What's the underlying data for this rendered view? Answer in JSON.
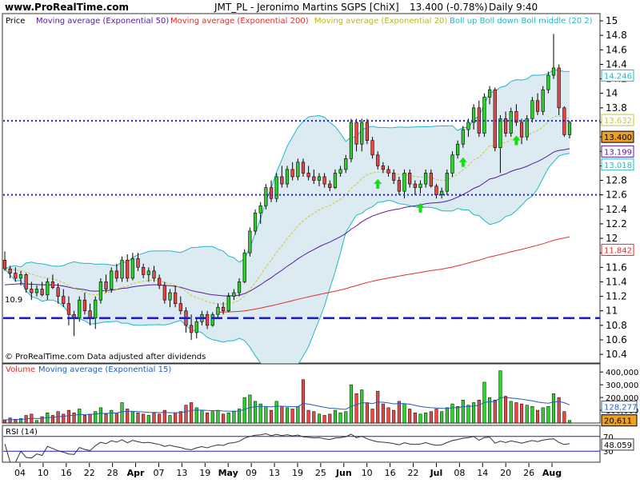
{
  "header": {
    "site": "www.ProRealTime.com",
    "title": "JMT_PL - Jeronimo Martins SGPS  [ChiX]",
    "price": "13.400 (-0.78%)",
    "period": "Daily  9:40"
  },
  "price_panel": {
    "label": "Price",
    "legend": [
      {
        "text": "Moving average (Exponential 50)",
        "color": "#5a189a"
      },
      {
        "text": "Moving average (Exponential 200)",
        "color": "#e0302a"
      },
      {
        "text": "Moving average (Exponential 20)",
        "color": "#c8c832"
      },
      {
        "text": "Boll up Boll down Boll middle (20 2)",
        "color": "#20b8c8"
      }
    ],
    "footer": "© ProRealTime.com  Data adjusted after dividends",
    "level_label": "10.9",
    "y_ticks": [
      "15",
      "14.8",
      "14.6",
      "14.4",
      "14.2",
      "14",
      "13.8",
      "13.6",
      "13.4",
      "13.2",
      "13",
      "12.8",
      "12.6",
      "12.4",
      "12.2",
      "12",
      "11.8",
      "11.6",
      "11.4",
      "11.2",
      "11",
      "10.8",
      "10.6",
      "10.4"
    ],
    "value_boxes": [
      {
        "text": "14.246",
        "value": 14.246,
        "color": "#20b8c8"
      },
      {
        "text": "13.632",
        "value": 13.632,
        "color": "#c8c832"
      },
      {
        "text": "13.400",
        "value": 13.4,
        "color": "#000000",
        "bg": "#f0a020"
      },
      {
        "text": "13.199",
        "value": 13.199,
        "color": "#5a189a"
      },
      {
        "text": "13.018",
        "value": 13.018,
        "color": "#20b8c8"
      },
      {
        "text": "11.842",
        "value": 11.842,
        "color": "#e0302a"
      }
    ]
  },
  "volume_panel": {
    "label": "Volume",
    "ma_label": "Moving average (Exponential 15)",
    "y_ticks": [
      "400,000",
      "300,000",
      "200,000",
      "100,000"
    ],
    "value_boxes": [
      {
        "text": "128,277",
        "value": 128277,
        "color": "#1f5fbf"
      },
      {
        "text": "20,611",
        "value": 20611,
        "color": "#000000",
        "bg": "#f0a020"
      }
    ]
  },
  "rsi_panel": {
    "label": "RSI (14)",
    "y_ticks": [
      "70",
      "30"
    ],
    "value_box": {
      "text": "48.059",
      "value": 48.059
    }
  },
  "x_axis": {
    "labels": [
      {
        "text": "04",
        "bold": false
      },
      {
        "text": "10",
        "bold": false
      },
      {
        "text": "16",
        "bold": false
      },
      {
        "text": "22",
        "bold": false
      },
      {
        "text": "28",
        "bold": false
      },
      {
        "text": "Apr",
        "bold": true
      },
      {
        "text": "07",
        "bold": false
      },
      {
        "text": "13",
        "bold": false
      },
      {
        "text": "19",
        "bold": false
      },
      {
        "text": "May",
        "bold": true
      },
      {
        "text": "09",
        "bold": false
      },
      {
        "text": "13",
        "bold": false
      },
      {
        "text": "19",
        "bold": false
      },
      {
        "text": "25",
        "bold": false
      },
      {
        "text": "Jun",
        "bold": true
      },
      {
        "text": "10",
        "bold": false
      },
      {
        "text": "16",
        "bold": false
      },
      {
        "text": "22",
        "bold": false
      },
      {
        "text": "Jul",
        "bold": true
      },
      {
        "text": "08",
        "bold": false
      },
      {
        "text": "14",
        "bold": false
      },
      {
        "text": "20",
        "bold": false
      },
      {
        "text": "26",
        "bold": false
      },
      {
        "text": "Aug",
        "bold": true
      }
    ]
  },
  "chart_data": {
    "type": "candlestick",
    "instrument": "JMT_PL - Jeronimo Martins SGPS [ChiX]",
    "ylim": [
      10.28,
      15.1
    ],
    "reference_lines": [
      13.62,
      12.6,
      10.9
    ],
    "arrows_at_candle": [
      70,
      78,
      86,
      96
    ],
    "candles": [
      {
        "o": 11.7,
        "h": 11.82,
        "l": 11.55,
        "c": 11.58,
        "v": 25000
      },
      {
        "o": 11.58,
        "h": 11.62,
        "l": 11.45,
        "c": 11.52,
        "v": 40000
      },
      {
        "o": 11.52,
        "h": 11.6,
        "l": 11.4,
        "c": 11.45,
        "v": 30000
      },
      {
        "o": 11.45,
        "h": 11.55,
        "l": 11.35,
        "c": 11.5,
        "v": 35000
      },
      {
        "o": 11.5,
        "h": 11.52,
        "l": 11.25,
        "c": 11.3,
        "v": 60000
      },
      {
        "o": 11.3,
        "h": 11.4,
        "l": 11.15,
        "c": 11.25,
        "v": 70000
      },
      {
        "o": 11.25,
        "h": 11.35,
        "l": 11.2,
        "c": 11.3,
        "v": 20000
      },
      {
        "o": 11.3,
        "h": 11.4,
        "l": 11.2,
        "c": 11.22,
        "v": 50000
      },
      {
        "o": 11.22,
        "h": 11.45,
        "l": 11.15,
        "c": 11.4,
        "v": 80000
      },
      {
        "o": 11.4,
        "h": 11.5,
        "l": 11.3,
        "c": 11.32,
        "v": 60000
      },
      {
        "o": 11.32,
        "h": 11.38,
        "l": 11.1,
        "c": 11.2,
        "v": 90000
      },
      {
        "o": 11.2,
        "h": 11.3,
        "l": 11.05,
        "c": 11.1,
        "v": 70000
      },
      {
        "o": 11.1,
        "h": 11.2,
        "l": 10.8,
        "c": 10.95,
        "v": 100000
      },
      {
        "o": 10.95,
        "h": 11.0,
        "l": 10.65,
        "c": 10.9,
        "v": 80000
      },
      {
        "o": 10.9,
        "h": 11.2,
        "l": 10.85,
        "c": 11.15,
        "v": 110000
      },
      {
        "o": 11.15,
        "h": 11.25,
        "l": 10.95,
        "c": 11.0,
        "v": 60000
      },
      {
        "o": 11.0,
        "h": 11.1,
        "l": 10.8,
        "c": 10.9,
        "v": 70000
      },
      {
        "o": 10.9,
        "h": 11.2,
        "l": 10.75,
        "c": 11.15,
        "v": 90000
      },
      {
        "o": 11.15,
        "h": 11.45,
        "l": 11.1,
        "c": 11.4,
        "v": 120000
      },
      {
        "o": 11.4,
        "h": 11.5,
        "l": 11.25,
        "c": 11.3,
        "v": 70000
      },
      {
        "o": 11.3,
        "h": 11.6,
        "l": 11.25,
        "c": 11.55,
        "v": 100000
      },
      {
        "o": 11.55,
        "h": 11.65,
        "l": 11.4,
        "c": 11.45,
        "v": 80000
      },
      {
        "o": 11.45,
        "h": 11.75,
        "l": 11.4,
        "c": 11.7,
        "v": 160000
      },
      {
        "o": 11.7,
        "h": 11.78,
        "l": 11.4,
        "c": 11.45,
        "v": 110000
      },
      {
        "o": 11.45,
        "h": 11.8,
        "l": 11.42,
        "c": 11.72,
        "v": 90000
      },
      {
        "o": 11.72,
        "h": 11.8,
        "l": 11.55,
        "c": 11.6,
        "v": 80000
      },
      {
        "o": 11.6,
        "h": 11.65,
        "l": 11.45,
        "c": 11.5,
        "v": 70000
      },
      {
        "o": 11.5,
        "h": 11.6,
        "l": 11.4,
        "c": 11.55,
        "v": 60000
      },
      {
        "o": 11.55,
        "h": 11.62,
        "l": 11.4,
        "c": 11.45,
        "v": 80000
      },
      {
        "o": 11.45,
        "h": 11.5,
        "l": 11.3,
        "c": 11.35,
        "v": 70000
      },
      {
        "o": 11.35,
        "h": 11.4,
        "l": 11.1,
        "c": 11.15,
        "v": 100000
      },
      {
        "o": 11.15,
        "h": 11.3,
        "l": 11.05,
        "c": 11.25,
        "v": 60000
      },
      {
        "o": 11.25,
        "h": 11.35,
        "l": 11.05,
        "c": 11.1,
        "v": 80000
      },
      {
        "o": 11.1,
        "h": 11.2,
        "l": 10.95,
        "c": 11.0,
        "v": 90000
      },
      {
        "o": 11.0,
        "h": 11.05,
        "l": 10.7,
        "c": 10.8,
        "v": 140000
      },
      {
        "o": 10.8,
        "h": 10.95,
        "l": 10.6,
        "c": 10.7,
        "v": 160000
      },
      {
        "o": 10.7,
        "h": 10.9,
        "l": 10.62,
        "c": 10.85,
        "v": 120000
      },
      {
        "o": 10.85,
        "h": 11.0,
        "l": 10.8,
        "c": 10.95,
        "v": 100000
      },
      {
        "o": 10.95,
        "h": 11.0,
        "l": 10.75,
        "c": 10.8,
        "v": 80000
      },
      {
        "o": 10.8,
        "h": 10.98,
        "l": 10.78,
        "c": 10.95,
        "v": 90000
      },
      {
        "o": 10.95,
        "h": 11.1,
        "l": 10.9,
        "c": 11.05,
        "v": 100000
      },
      {
        "o": 11.05,
        "h": 11.12,
        "l": 10.95,
        "c": 11.0,
        "v": 70000
      },
      {
        "o": 11.0,
        "h": 11.25,
        "l": 10.98,
        "c": 11.2,
        "v": 80000
      },
      {
        "o": 11.2,
        "h": 11.3,
        "l": 11.15,
        "c": 11.25,
        "v": 90000
      },
      {
        "o": 11.25,
        "h": 11.45,
        "l": 11.2,
        "c": 11.4,
        "v": 110000
      },
      {
        "o": 11.4,
        "h": 11.85,
        "l": 11.38,
        "c": 11.8,
        "v": 200000
      },
      {
        "o": 11.8,
        "h": 12.15,
        "l": 11.75,
        "c": 12.1,
        "v": 220000
      },
      {
        "o": 12.1,
        "h": 12.4,
        "l": 12.05,
        "c": 12.35,
        "v": 170000
      },
      {
        "o": 12.35,
        "h": 12.5,
        "l": 12.2,
        "c": 12.45,
        "v": 150000
      },
      {
        "o": 12.45,
        "h": 12.75,
        "l": 12.4,
        "c": 12.7,
        "v": 130000
      },
      {
        "o": 12.7,
        "h": 12.8,
        "l": 12.5,
        "c": 12.55,
        "v": 100000
      },
      {
        "o": 12.55,
        "h": 12.9,
        "l": 12.5,
        "c": 12.85,
        "v": 170000
      },
      {
        "o": 12.85,
        "h": 13.0,
        "l": 12.7,
        "c": 12.75,
        "v": 130000
      },
      {
        "o": 12.75,
        "h": 13.0,
        "l": 12.7,
        "c": 12.95,
        "v": 120000
      },
      {
        "o": 12.95,
        "h": 13.05,
        "l": 12.8,
        "c": 12.85,
        "v": 110000
      },
      {
        "o": 12.85,
        "h": 13.1,
        "l": 12.8,
        "c": 13.05,
        "v": 130000
      },
      {
        "o": 13.05,
        "h": 13.1,
        "l": 12.85,
        "c": 12.9,
        "v": 340000
      },
      {
        "o": 12.9,
        "h": 13.0,
        "l": 12.8,
        "c": 12.85,
        "v": 100000
      },
      {
        "o": 12.85,
        "h": 12.95,
        "l": 12.75,
        "c": 12.8,
        "v": 90000
      },
      {
        "o": 12.8,
        "h": 12.9,
        "l": 12.72,
        "c": 12.85,
        "v": 70000
      },
      {
        "o": 12.85,
        "h": 12.9,
        "l": 12.7,
        "c": 12.75,
        "v": 60000
      },
      {
        "o": 12.75,
        "h": 12.8,
        "l": 12.65,
        "c": 12.7,
        "v": 70000
      },
      {
        "o": 12.7,
        "h": 12.95,
        "l": 12.68,
        "c": 12.9,
        "v": 100000
      },
      {
        "o": 12.9,
        "h": 13.0,
        "l": 12.85,
        "c": 12.95,
        "v": 80000
      },
      {
        "o": 12.95,
        "h": 13.15,
        "l": 12.9,
        "c": 13.1,
        "v": 90000
      },
      {
        "o": 13.1,
        "h": 13.65,
        "l": 13.05,
        "c": 13.6,
        "v": 300000
      },
      {
        "o": 13.6,
        "h": 13.65,
        "l": 13.2,
        "c": 13.3,
        "v": 230000
      },
      {
        "o": 13.3,
        "h": 13.65,
        "l": 13.2,
        "c": 13.6,
        "v": 260000
      },
      {
        "o": 13.6,
        "h": 13.65,
        "l": 13.3,
        "c": 13.35,
        "v": 160000
      },
      {
        "o": 13.35,
        "h": 13.4,
        "l": 13.1,
        "c": 13.15,
        "v": 110000
      },
      {
        "o": 13.15,
        "h": 13.2,
        "l": 12.95,
        "c": 13.0,
        "v": 250000
      },
      {
        "o": 13.0,
        "h": 13.05,
        "l": 12.9,
        "c": 12.95,
        "v": 150000
      },
      {
        "o": 12.95,
        "h": 13.0,
        "l": 12.85,
        "c": 12.9,
        "v": 120000
      },
      {
        "o": 12.9,
        "h": 12.95,
        "l": 12.75,
        "c": 12.8,
        "v": 100000
      },
      {
        "o": 12.8,
        "h": 12.85,
        "l": 12.6,
        "c": 12.65,
        "v": 170000
      },
      {
        "o": 12.65,
        "h": 12.95,
        "l": 12.55,
        "c": 12.9,
        "v": 150000
      },
      {
        "o": 12.9,
        "h": 12.95,
        "l": 12.7,
        "c": 12.75,
        "v": 110000
      },
      {
        "o": 12.75,
        "h": 12.8,
        "l": 12.6,
        "c": 12.7,
        "v": 80000
      },
      {
        "o": 12.7,
        "h": 12.8,
        "l": 12.62,
        "c": 12.75,
        "v": 70000
      },
      {
        "o": 12.75,
        "h": 12.95,
        "l": 12.7,
        "c": 12.9,
        "v": 80000
      },
      {
        "o": 12.9,
        "h": 12.95,
        "l": 12.7,
        "c": 12.72,
        "v": 90000
      },
      {
        "o": 12.72,
        "h": 12.75,
        "l": 12.55,
        "c": 12.6,
        "v": 110000
      },
      {
        "o": 12.6,
        "h": 12.7,
        "l": 12.55,
        "c": 12.65,
        "v": 90000
      },
      {
        "o": 12.65,
        "h": 12.95,
        "l": 12.6,
        "c": 12.9,
        "v": 120000
      },
      {
        "o": 12.9,
        "h": 13.2,
        "l": 12.85,
        "c": 13.15,
        "v": 150000
      },
      {
        "o": 13.15,
        "h": 13.35,
        "l": 13.1,
        "c": 13.3,
        "v": 130000
      },
      {
        "o": 13.3,
        "h": 13.55,
        "l": 13.25,
        "c": 13.5,
        "v": 180000
      },
      {
        "o": 13.5,
        "h": 13.65,
        "l": 13.4,
        "c": 13.6,
        "v": 140000
      },
      {
        "o": 13.6,
        "h": 13.85,
        "l": 13.5,
        "c": 13.8,
        "v": 160000
      },
      {
        "o": 13.8,
        "h": 13.9,
        "l": 13.4,
        "c": 13.45,
        "v": 180000
      },
      {
        "o": 13.45,
        "h": 14.0,
        "l": 13.4,
        "c": 13.95,
        "v": 320000
      },
      {
        "o": 13.95,
        "h": 14.1,
        "l": 13.85,
        "c": 14.05,
        "v": 200000
      },
      {
        "o": 14.05,
        "h": 14.08,
        "l": 13.2,
        "c": 13.25,
        "v": 180000
      },
      {
        "o": 13.25,
        "h": 13.7,
        "l": 12.9,
        "c": 13.65,
        "v": 410000
      },
      {
        "o": 13.65,
        "h": 13.75,
        "l": 13.4,
        "c": 13.45,
        "v": 210000
      },
      {
        "o": 13.45,
        "h": 13.8,
        "l": 13.4,
        "c": 13.75,
        "v": 170000
      },
      {
        "o": 13.75,
        "h": 13.85,
        "l": 13.55,
        "c": 13.6,
        "v": 160000
      },
      {
        "o": 13.6,
        "h": 13.65,
        "l": 13.3,
        "c": 13.4,
        "v": 150000
      },
      {
        "o": 13.4,
        "h": 13.7,
        "l": 13.35,
        "c": 13.65,
        "v": 140000
      },
      {
        "o": 13.65,
        "h": 13.95,
        "l": 13.6,
        "c": 13.9,
        "v": 130000
      },
      {
        "o": 13.9,
        "h": 14.0,
        "l": 13.7,
        "c": 13.75,
        "v": 100000
      },
      {
        "o": 13.75,
        "h": 14.1,
        "l": 13.7,
        "c": 14.05,
        "v": 120000
      },
      {
        "o": 14.05,
        "h": 14.3,
        "l": 14.0,
        "c": 14.25,
        "v": 130000
      },
      {
        "o": 14.25,
        "h": 14.82,
        "l": 14.2,
        "c": 14.35,
        "v": 230000
      },
      {
        "o": 14.35,
        "h": 14.4,
        "l": 13.7,
        "c": 13.8,
        "v": 200000
      },
      {
        "o": 13.8,
        "h": 13.82,
        "l": 13.4,
        "c": 13.43,
        "v": 90000
      },
      {
        "o": 13.43,
        "h": 13.62,
        "l": 13.38,
        "c": 13.6,
        "v": 20611
      }
    ]
  }
}
